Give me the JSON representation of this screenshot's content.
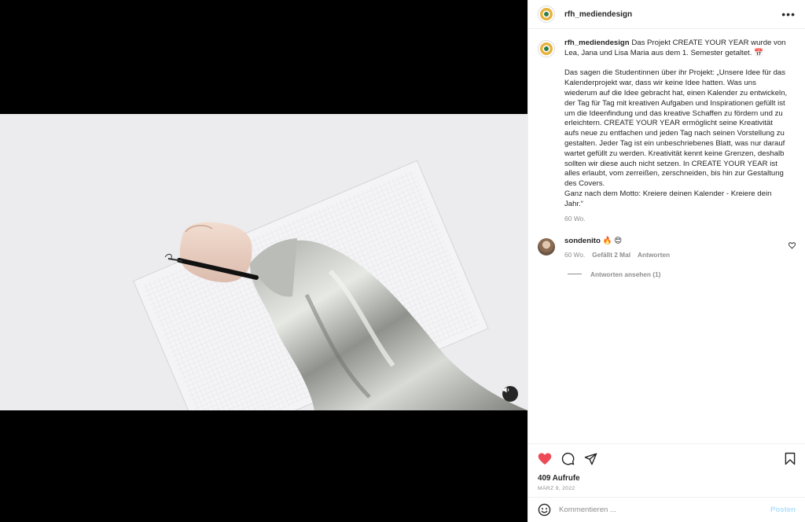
{
  "post": {
    "username": "rfh_mediendesign",
    "more_icon": "more-icon",
    "caption": "Das Projekt CREATE YOUR YEAR wurde von Lea, Jana und Lisa Maria aus dem 1. Semester getaltet. 📅\n\nDas sagen die Studentinnen über ihr Projekt: „Unsere Idee für das Kalenderprojekt war, dass wir keine Idee hatten. Was uns wiederum auf die Idee gebracht hat, einen Kalender zu entwickeln, der Tag für Tag mit kreativen Aufgaben und Inspirationen gefüllt ist um die Ideenfindung und das kreative Schaffen zu fördern und zu erleichtern. CREATE YOUR YEAR ermöglicht seine Kreativität aufs neue zu entfachen und jeden Tag nach seinen Vorstellung zu gestalten. Jeder Tag ist ein unbeschriebenes Blatt, was nur darauf wartet gefüllt zu werden. Kreativität kennt keine Grenzen, deshalb sollten wir diese auch nicht setzen. In CREATE YOUR YEAR ist alles erlaubt, vom zerreißen, zerschneiden, bis hin zur Gestaltung des Covers.\nGanz nach dem Motto: Kreiere deinen Kalender - Kreiere dein Jahr.“",
    "caption_age": "60 Wo."
  },
  "comment": {
    "username": "sondenito",
    "text": "🔥 😍",
    "age": "60 Wo.",
    "likes": "Gefällt 2 Mal",
    "reply_label": "Antworten",
    "view_replies": "Antworten ansehen (1)"
  },
  "stats": {
    "views": "409 Aufrufe",
    "date": "MÄRZ 9, 2022"
  },
  "composer": {
    "placeholder": "Kommentieren ...",
    "post_label": "Posten"
  },
  "colors": {
    "like_red": "#ed4956",
    "post_disabled": "#b2dffc",
    "secondary_text": "#8e8e8e"
  },
  "icons": [
    "heart-icon",
    "comment-icon",
    "share-icon",
    "bookmark-icon",
    "emoji-icon",
    "mute-icon"
  ]
}
